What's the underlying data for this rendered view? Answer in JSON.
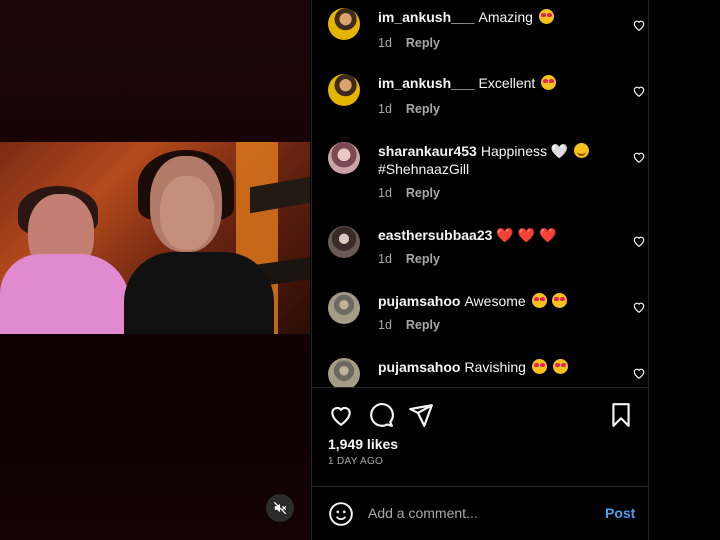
{
  "comments": [
    {
      "user": "im_ankush___",
      "text": "Amazing",
      "emoji": "heart-eyes",
      "age": "1d",
      "reply": "Reply"
    },
    {
      "user": "im_ankush___",
      "text": "Excellent",
      "emoji": "heart-eyes",
      "age": "1d",
      "reply": "Reply"
    },
    {
      "user": "sharankaur453",
      "text": "Happiness 🤍",
      "text2": "#ShehnaazGill",
      "emoji": "smile",
      "age": "1d",
      "reply": "Reply"
    },
    {
      "user": "easthersubbaa23",
      "text": "❤️ ❤️ ❤️",
      "age": "1d",
      "reply": "Reply"
    },
    {
      "user": "pujamsahoo",
      "text": "Awesome",
      "emoji": "heart-eyes x2",
      "age": "1d",
      "reply": "Reply"
    },
    {
      "user": "pujamsahoo",
      "text": "Ravishing",
      "emoji": "heart-eyes x2"
    }
  ],
  "likes": "1,949 likes",
  "posted": "1 DAY AGO",
  "add_comment_placeholder": "Add a comment...",
  "post_label": "Post",
  "colors": {
    "accent": "#4f9ce8",
    "panel_bg": "#000000",
    "muted_text": "#a8a8a8"
  }
}
